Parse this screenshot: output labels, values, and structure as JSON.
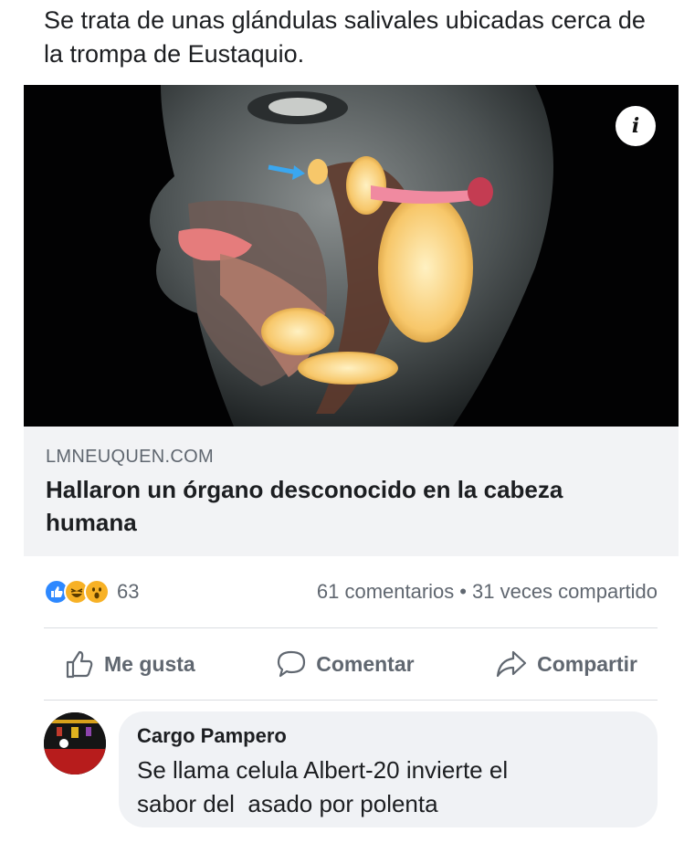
{
  "post": {
    "text": "Se trata de unas glándulas salivales ubicadas cerca de la trompa de Eustaquio."
  },
  "link": {
    "image_alt": "human-head-anatomy-illustration",
    "info_icon": "info-icon",
    "info_glyph": "i",
    "domain": "LMNEUQUEN.COM",
    "title": "Hallaron un órgano desconocido en la cabeza humana"
  },
  "stats": {
    "reaction_icons": [
      "like-icon",
      "haha-icon",
      "wow-icon"
    ],
    "reaction_count": "63",
    "comments": "61 comentarios",
    "separator": "•",
    "shares": "31 veces compartido"
  },
  "actions": {
    "like_label": "Me gusta",
    "comment_label": "Comentar",
    "share_label": "Compartir"
  },
  "comment": {
    "author": "Cargo Pampero",
    "text": "Se llama celula Albert-20 invierte el\nsabor del  asado por polenta"
  },
  "colors": {
    "like_blue": "#2d88ff",
    "reaction_yellow": "#f7b125",
    "muted_text": "#606770",
    "meta_background": "#f2f3f5"
  }
}
